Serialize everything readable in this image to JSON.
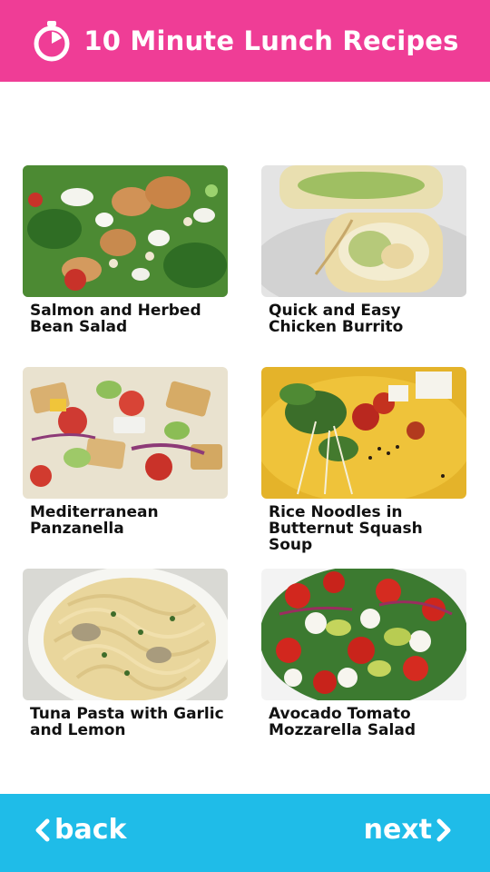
{
  "header": {
    "title": "10 Minute Lunch Recipes",
    "icon": "stopwatch-icon",
    "background": "#ef3d96"
  },
  "recipes": [
    {
      "name": "Salmon and Herbed Bean Salad"
    },
    {
      "name": "Quick and Easy Chicken Burrito"
    },
    {
      "name": "Mediterranean Panzanella"
    },
    {
      "name": "Rice Noodles in Butternut Squash Soup"
    },
    {
      "name": "Tuna Pasta with Garlic and Lemon"
    },
    {
      "name": "Avocado Tomato Mozzarella Salad"
    }
  ],
  "footer": {
    "back_label": "back",
    "next_label": "next",
    "background": "#1fbce8"
  }
}
